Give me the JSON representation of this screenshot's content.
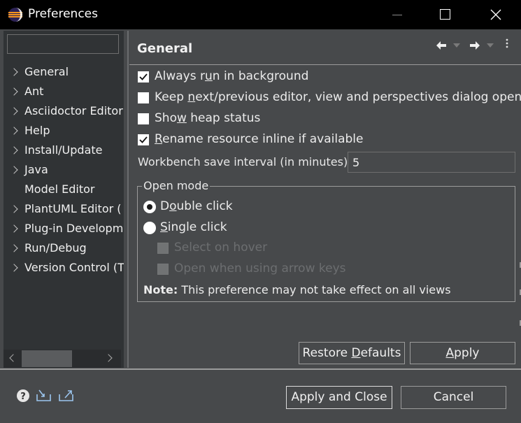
{
  "window": {
    "title": "Preferences",
    "controls": [
      "minimize",
      "maximize",
      "close"
    ]
  },
  "sidebar": {
    "filter_placeholder": "",
    "filter_value": "",
    "items": [
      {
        "label": "General",
        "expandable": true
      },
      {
        "label": "Ant",
        "expandable": true
      },
      {
        "label": "Asciidoctor Editor",
        "expandable": true
      },
      {
        "label": "Help",
        "expandable": true
      },
      {
        "label": "Install/Update",
        "expandable": true
      },
      {
        "label": "Java",
        "expandable": true
      },
      {
        "label": "Model Editor",
        "expandable": false
      },
      {
        "label": "PlantUML Editor (",
        "expandable": true
      },
      {
        "label": "Plug-in Developm",
        "expandable": true
      },
      {
        "label": "Run/Debug",
        "expandable": true
      },
      {
        "label": "Version Control (T",
        "expandable": true
      }
    ]
  },
  "page": {
    "title": "General",
    "options": [
      {
        "pre": "Always r",
        "u": "u",
        "post": "n in background",
        "checked": true,
        "enabled": true
      },
      {
        "pre": "Keep ",
        "u": "n",
        "post": "ext/previous editor, view and perspectives dialog open",
        "checked": false,
        "enabled": true
      },
      {
        "pre": "Sho",
        "u": "w",
        "post": " heap status",
        "checked": false,
        "enabled": true
      },
      {
        "pre": "",
        "u": "R",
        "post": "ename resource inline if available",
        "checked": true,
        "enabled": true
      }
    ],
    "interval_label": "Workbench save interval (in minutes):",
    "interval_value": "5",
    "open_mode": {
      "legend": "Open mode",
      "radios": [
        {
          "pre": "D",
          "u": "o",
          "post": "uble click",
          "selected": true
        },
        {
          "pre": "",
          "u": "S",
          "post": "ingle click",
          "selected": false
        }
      ],
      "sub_options": [
        {
          "label": "Select on hover",
          "checked": false,
          "enabled": false
        },
        {
          "label": "Open when using arrow keys",
          "checked": false,
          "enabled": false
        }
      ],
      "note_bold": "Note:",
      "note_text": " This preference may not take effect on all views"
    },
    "restore_pre": "Restore ",
    "restore_u": "D",
    "restore_post": "efaults",
    "apply_u": "A",
    "apply_post": "pply"
  },
  "footer": {
    "apply_close": "Apply and Close",
    "cancel": "Cancel",
    "icons": [
      "help-icon",
      "import-icon",
      "export-icon"
    ]
  },
  "colors": {
    "titlebar": "#000000",
    "background": "#47494b",
    "sidebar": "#303335",
    "text": "#e8e8e8"
  }
}
